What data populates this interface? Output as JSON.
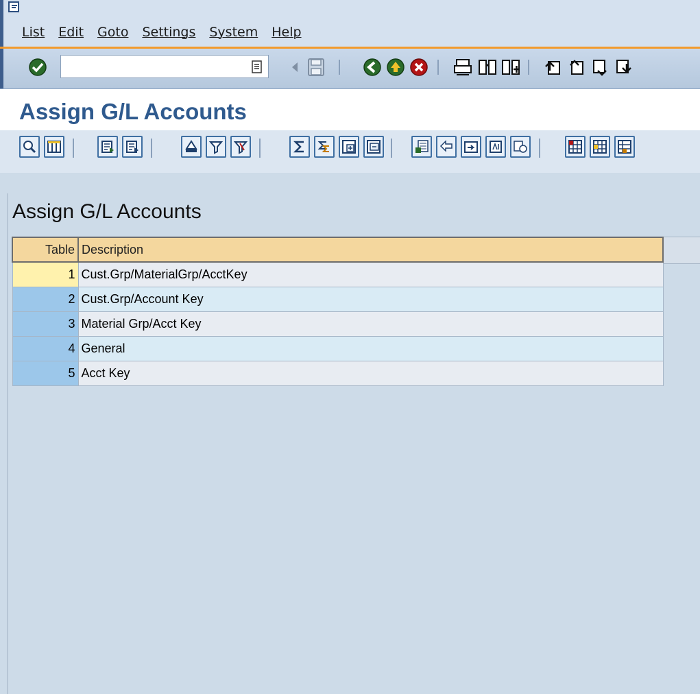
{
  "menubar": {
    "items": [
      "List",
      "Edit",
      "Goto",
      "Settings",
      "System",
      "Help"
    ]
  },
  "system_toolbar": {
    "command_field": {
      "value": ""
    },
    "icons": [
      "enter-icon",
      "command-dropdown-icon",
      "back-arrow-icon",
      "save-icon",
      "back-icon",
      "exit-icon",
      "cancel-icon",
      "print-icon",
      "find-icon",
      "find-next-icon",
      "first-page-icon",
      "previous-page-icon",
      "next-page-icon",
      "last-page-icon"
    ]
  },
  "title": "Assign G/L Accounts",
  "app_toolbar": {
    "icons": [
      "details-icon",
      "choose-layout-icon",
      "sort-ascending-icon",
      "sort-descending-icon",
      "find-icon",
      "set-filter-icon",
      "filter-icon",
      "total-icon",
      "subtotal-icon",
      "expand-icon",
      "collapse-icon",
      "excel-icon",
      "word-processing-icon",
      "local-file-icon",
      "abc-analysis-icon",
      "graphic-icon",
      "change-layout-icon",
      "select-layout-icon",
      "save-layout-icon"
    ]
  },
  "list": {
    "title": "Assign G/L Accounts",
    "columns": [
      "Table",
      "Description"
    ],
    "rows": [
      {
        "table": "1",
        "description": "Cust.Grp/MaterialGrp/AcctKey"
      },
      {
        "table": "2",
        "description": "Cust.Grp/Account Key"
      },
      {
        "table": "3",
        "description": "Material Grp/Acct Key"
      },
      {
        "table": "4",
        "description": "General"
      },
      {
        "table": "5",
        "description": "Acct Key"
      }
    ]
  },
  "colors": {
    "title": "#2f5a8e",
    "header_bg": "#f4d79e",
    "key_column_bg": "#9cc7ea",
    "selected_key_bg": "#fff2ad",
    "accent_orange": "#f29a2c"
  }
}
